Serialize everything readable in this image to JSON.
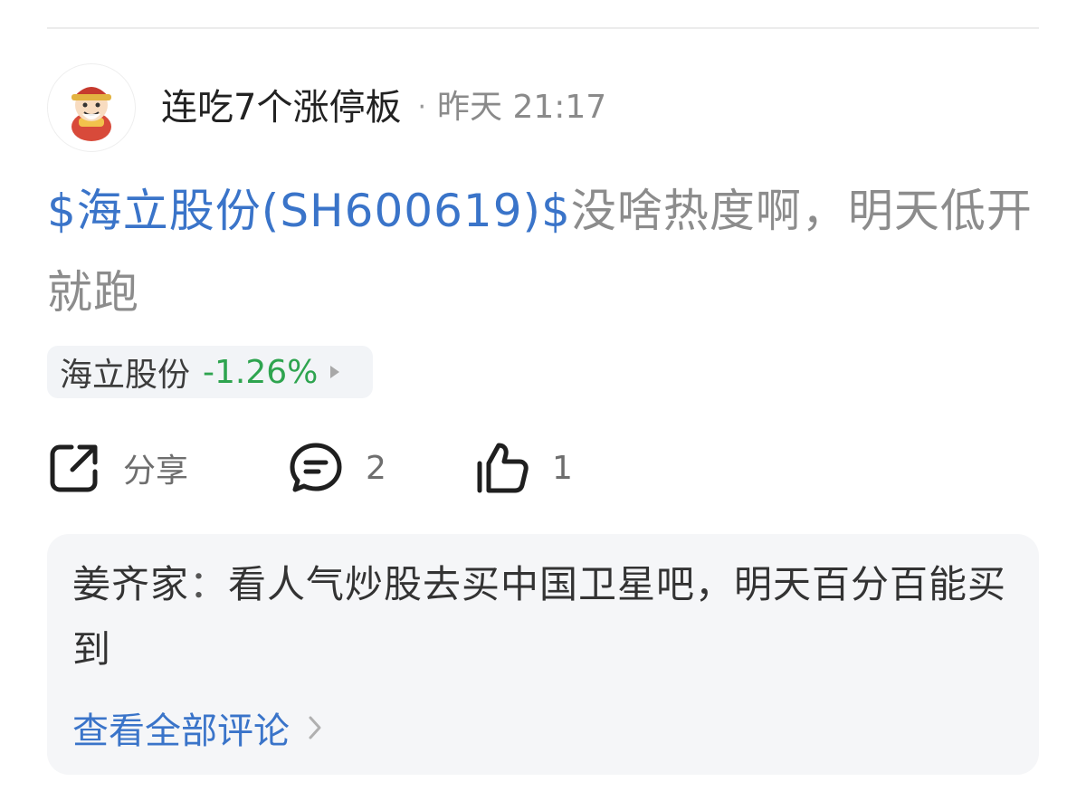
{
  "post": {
    "author": "连吃7个涨停板",
    "separator": "·",
    "time": "昨天 21:17",
    "stock_link": "$海立股份(SH600619)$",
    "content": "没啥热度啊，明天低开就跑"
  },
  "stock_chip": {
    "name": "海立股份",
    "change": "-1.26%",
    "change_color": "#2ea44f"
  },
  "actions": {
    "share_label": "分享",
    "comment_count": "2",
    "like_count": "1"
  },
  "comment": {
    "author": "姜齐家",
    "separator": "：",
    "text": "看人气炒股去买中国卫星吧，明天百分百能买到"
  },
  "view_all_label": "查看全部评论",
  "icons": {
    "share": "share-icon",
    "comment": "comment-icon",
    "like": "thumbs-up-icon",
    "chip_arrow": "triangle-right-icon",
    "view_all": "chevron-right-icon"
  },
  "colors": {
    "link": "#3a74c9",
    "body_text": "#8c8c8c"
  }
}
